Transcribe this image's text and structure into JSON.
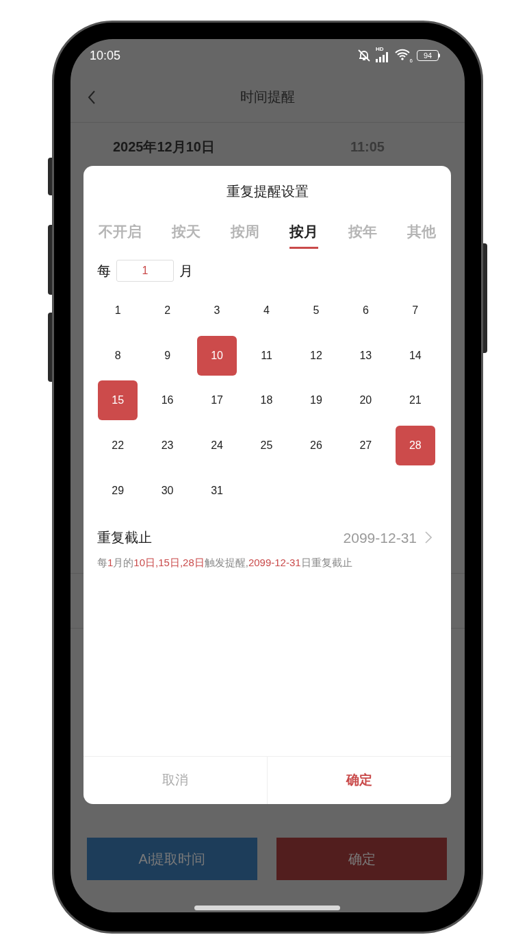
{
  "status_bar": {
    "time": "10:05",
    "network_label": "HD",
    "wifi_label": "6",
    "battery": "94"
  },
  "header": {
    "title": "时间提醒"
  },
  "background_row": {
    "date": "2025年12月10日",
    "time": "11:05"
  },
  "dialog": {
    "title": "重复提醒设置",
    "tabs": [
      {
        "label": "不开启",
        "selected": false
      },
      {
        "label": "按天",
        "selected": false
      },
      {
        "label": "按周",
        "selected": false
      },
      {
        "label": "按月",
        "selected": true
      },
      {
        "label": "按年",
        "selected": false
      },
      {
        "label": "其他",
        "selected": false
      }
    ],
    "interval": {
      "prefix": "每",
      "value": "1",
      "suffix": "月"
    },
    "days": [
      {
        "label": "1",
        "selected": false
      },
      {
        "label": "2",
        "selected": false
      },
      {
        "label": "3",
        "selected": false
      },
      {
        "label": "4",
        "selected": false
      },
      {
        "label": "5",
        "selected": false
      },
      {
        "label": "6",
        "selected": false
      },
      {
        "label": "7",
        "selected": false
      },
      {
        "label": "8",
        "selected": false
      },
      {
        "label": "9",
        "selected": false
      },
      {
        "label": "10",
        "selected": true
      },
      {
        "label": "11",
        "selected": false
      },
      {
        "label": "12",
        "selected": false
      },
      {
        "label": "13",
        "selected": false
      },
      {
        "label": "14",
        "selected": false
      },
      {
        "label": "15",
        "selected": true
      },
      {
        "label": "16",
        "selected": false
      },
      {
        "label": "17",
        "selected": false
      },
      {
        "label": "18",
        "selected": false
      },
      {
        "label": "19",
        "selected": false
      },
      {
        "label": "20",
        "selected": false
      },
      {
        "label": "21",
        "selected": false
      },
      {
        "label": "22",
        "selected": false
      },
      {
        "label": "23",
        "selected": false
      },
      {
        "label": "24",
        "selected": false
      },
      {
        "label": "25",
        "selected": false
      },
      {
        "label": "26",
        "selected": false
      },
      {
        "label": "27",
        "selected": false
      },
      {
        "label": "28",
        "selected": true
      },
      {
        "label": "29",
        "selected": false
      },
      {
        "label": "30",
        "selected": false
      },
      {
        "label": "31",
        "selected": false
      }
    ],
    "repeat_end": {
      "label": "重复截止",
      "value": "2099-12-31"
    },
    "summary": [
      {
        "text": "每",
        "highlight": false
      },
      {
        "text": "1",
        "highlight": true
      },
      {
        "text": "月的",
        "highlight": false
      },
      {
        "text": "10日,15日,28日",
        "highlight": true
      },
      {
        "text": "触发提醒,",
        "highlight": false
      },
      {
        "text": "2099-12-31",
        "highlight": true
      },
      {
        "text": "日重复截止",
        "highlight": false
      }
    ],
    "buttons": [
      {
        "label": "取消",
        "kind": "cancel"
      },
      {
        "label": "确定",
        "kind": "confirm"
      }
    ]
  },
  "bottom_buttons": [
    {
      "label": "Ai提取时间",
      "kind": "ai"
    },
    {
      "label": "确定",
      "kind": "confirm"
    }
  ]
}
